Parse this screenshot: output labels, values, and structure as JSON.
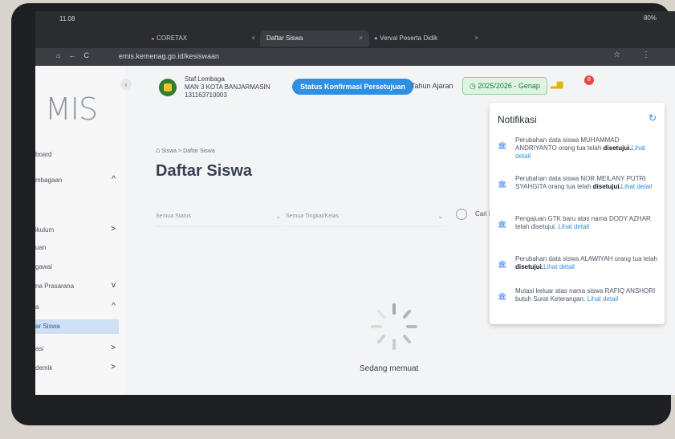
{
  "status_bar": {
    "time": "11.08",
    "system": "80%"
  },
  "browser": {
    "tabs": [
      {
        "label": "CORETAX"
      },
      {
        "label": "Daftar Siswa"
      },
      {
        "label": "Verval Peserta Didik"
      }
    ],
    "new_tab": "+",
    "url": "emis.kemenag.go.id/kesiswaan"
  },
  "sidebar": {
    "logo": "MIS",
    "items": [
      {
        "label": "board",
        "chevron": ""
      },
      {
        "label": "mbagaan",
        "chevron": "^"
      },
      {
        "label": "",
        "chevron": ""
      },
      {
        "label": "ikulum",
        "chevron": ">"
      },
      {
        "label": "uan",
        "chevron": ""
      },
      {
        "label": "gawai",
        "chevron": ""
      },
      {
        "label": "na Prasarana",
        "chevron": "v"
      },
      {
        "label": "a",
        "chevron": "^"
      },
      {
        "label": "ar Siswa",
        "chevron": ""
      },
      {
        "label": "asi",
        "chevron": ">"
      },
      {
        "label": "demik",
        "chevron": ">"
      }
    ]
  },
  "header": {
    "school_role": "Staf Lembaga",
    "school_name": "MAN 3 KOTA BANJARMASIN",
    "school_id": "131163710003",
    "status_button": "Status Konfirmasi Persetujuan",
    "academic_year_label": "Tahun Ajaran",
    "academic_year_value": "2025/2026 - Genap",
    "notif_count": "8"
  },
  "breadcrumb": {
    "first": "Siswa",
    "sep": ">",
    "second": "Daftar Siswa"
  },
  "page_title": "Daftar Siswa",
  "filters": {
    "status_placeholder": "Semua Status",
    "tingkat_placeholder": "Semua Tingkat/Kelas",
    "search_placeholder": "Cari N"
  },
  "loading_text": "Sedang memuat",
  "notifications": {
    "title": "Notifikasi",
    "items": [
      {
        "text": "Perubahan data siswa MUHAMMAD ANDRIYANTO orang tua telah",
        "bold": "disetujui.",
        "link": "Lihat detail"
      },
      {
        "text": "Perubahan data siswa NOR MEILANY PUTRI SYAHGITA orang tua telah",
        "bold": "disetujui.",
        "link": "Lihat detail"
      },
      {
        "text": "Pengajuan GTK baru atas nama DODY AZHAR telah disetujui.",
        "bold": "",
        "link": "Lihat detail"
      },
      {
        "text": "Perubahan data siswa ALAWIYAH orang tua telah",
        "bold": "disetujui.",
        "link": "Lihat detail"
      },
      {
        "text": "Mutasi keluar atas nama siswa RAFIQ ANSHORI butuh Surat Keterangan.",
        "bold": "",
        "link": "Lihat detail"
      }
    ]
  },
  "colors": {
    "primary": "#2e8fe3",
    "success": "#1f7a39",
    "danger": "#ef4444"
  }
}
